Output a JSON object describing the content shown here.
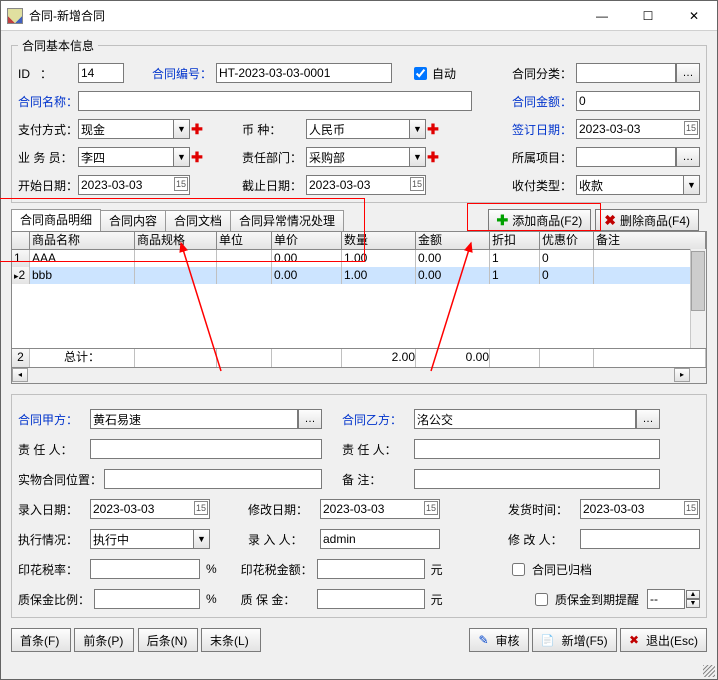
{
  "title": "合同-新增合同",
  "group_title": "合同基本信息",
  "fields": {
    "id_label": "ID",
    "id_colon": "：",
    "id_value": "14",
    "code_label": "合同编号：",
    "code_value": "HT-2023-03-03-0001",
    "auto_label": "自动",
    "category_label": "合同分类：",
    "name_label": "合同名称：",
    "amount_label": "合同金额：",
    "amount_value": "0",
    "paymethod_label": "支付方式：",
    "paymethod_value": "现金",
    "currency_label": "币      种：",
    "currency_value": "人民币",
    "signdate_label": "签订日期：",
    "signdate_value": "2023-03-03",
    "salesman_label": "业 务 员：",
    "salesman_value": "李四",
    "dept_label": "责任部门：",
    "dept_value": "采购部",
    "project_label": "所属项目：",
    "startdate_label": "开始日期：",
    "startdate_value": "2023-03-03",
    "enddate_label": "截止日期：",
    "enddate_value": "2023-03-03",
    "paytype_label": "收付类型：",
    "paytype_value": "收款"
  },
  "tabs": {
    "t1": "合同商品明细",
    "t2": "合同内容",
    "t3": "合同文档",
    "t4": "合同异常情况处理"
  },
  "toolbar": {
    "add_item": "添加商品(F2)",
    "del_item": "删除商品(F4)"
  },
  "grid": {
    "headers": {
      "name": "商品名称",
      "spec": "商品规格",
      "unit": "单位",
      "price": "单价",
      "qty": "数量",
      "amount": "金额",
      "discount": "折扣",
      "pref": "优惠价",
      "remark": "备注"
    },
    "rows": [
      {
        "idx": "1",
        "name": "AAA",
        "spec": "",
        "unit": "",
        "price": "0.00",
        "qty": "1.00",
        "amount": "0.00",
        "discount": "1",
        "pref": "0",
        "remark": ""
      },
      {
        "idx": "2",
        "name": "bbb",
        "spec": "",
        "unit": "",
        "price": "0.00",
        "qty": "1.00",
        "amount": "0.00",
        "discount": "1",
        "pref": "0",
        "remark": ""
      }
    ],
    "total": {
      "idx": "2",
      "label": "总计：",
      "qty": "2.00",
      "amount": "0.00"
    }
  },
  "lower": {
    "partyA_label": "合同甲方：",
    "partyA_value": "黄石易速",
    "partyB_label": "合同乙方：",
    "partyB_value": "洺公交",
    "respA_label": "责 任 人：",
    "respB_label": "责 任 人：",
    "phys_label": "实物合同位置：",
    "remark_label": "备    注：",
    "entrydate_label": "录入日期：",
    "entrydate_value": "2023-03-03",
    "modifydate_label": "修改日期：",
    "modifydate_value": "2023-03-03",
    "shipdate_label": "发货时间：",
    "shipdate_value": "2023-03-03",
    "exec_label": "执行情况：",
    "exec_value": "执行中",
    "entryuser_label": "录 入 人：",
    "entryuser_value": "admin",
    "modifyuser_label": "修 改 人：",
    "stamprate_label": "印花税率：",
    "percent": "%",
    "stampamt_label": "印花税金额：",
    "yuan": "元",
    "archived_label": "合同已归档",
    "bondrate_label": "质保金比例：",
    "bondamt_label": "质 保 金：",
    "bondremind_label": "质保金到期提醒",
    "bondremind_value": "--"
  },
  "nav": {
    "first": "首条(F)",
    "prev": "前条(P)",
    "next": "后条(N)",
    "last": "末条(L)"
  },
  "actions": {
    "audit": "审核",
    "new": "新增(F5)",
    "exit": "退出(Esc)"
  }
}
